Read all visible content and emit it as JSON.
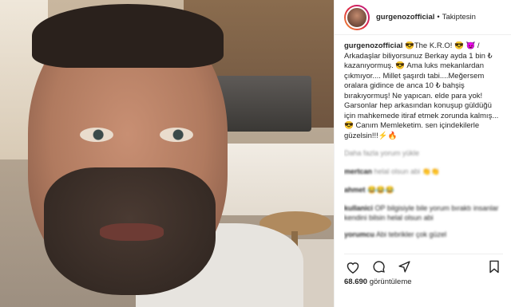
{
  "header": {
    "username": "gurgenozofficial",
    "separator": "•",
    "follow_label": "Takiptesin"
  },
  "caption": {
    "username": "gurgenozofficial",
    "text": " 😎The K.R.O! 😎 😈 / Arkadaşlar biliyorsunuz Berkay ayda 1 bin ₺ kazanıyormuş. 😎 Ama luks mekanlardan çıkmıyor.... Millet şaşırdı tabi....Meğersem oralara gidince de anca 10 ₺ bahşiş bırakıyormuş! Ne yapıcan. elde para yok! Garsonlar hep arkasından konuşup güldüğü için mahkemede itiraf etmek zorunda kalmış...😎 Canım Memleketim. sen içindekilerle güzelsin!!!⚡🔥"
  },
  "blurred_comments": [
    {
      "text": "Daha fazla yorum yükle"
    },
    {
      "user": "mertcan",
      "text": "helal olsun abi 👏👏"
    },
    {
      "user": "ahmet",
      "text": "😂😂😂"
    },
    {
      "user": "kullanici",
      "text": "OP bilgisiyle bile yorum bıraktı insanlar kendini bilsin helal olsun abi"
    },
    {
      "user": "yorumcu",
      "text": "Abi tebrikler çok güzel"
    }
  ],
  "actions": {
    "like": "heart-icon",
    "comment": "comment-icon",
    "share": "share-icon",
    "save": "bookmark-icon"
  },
  "views": {
    "count": "68.690",
    "label": "görüntüleme"
  }
}
